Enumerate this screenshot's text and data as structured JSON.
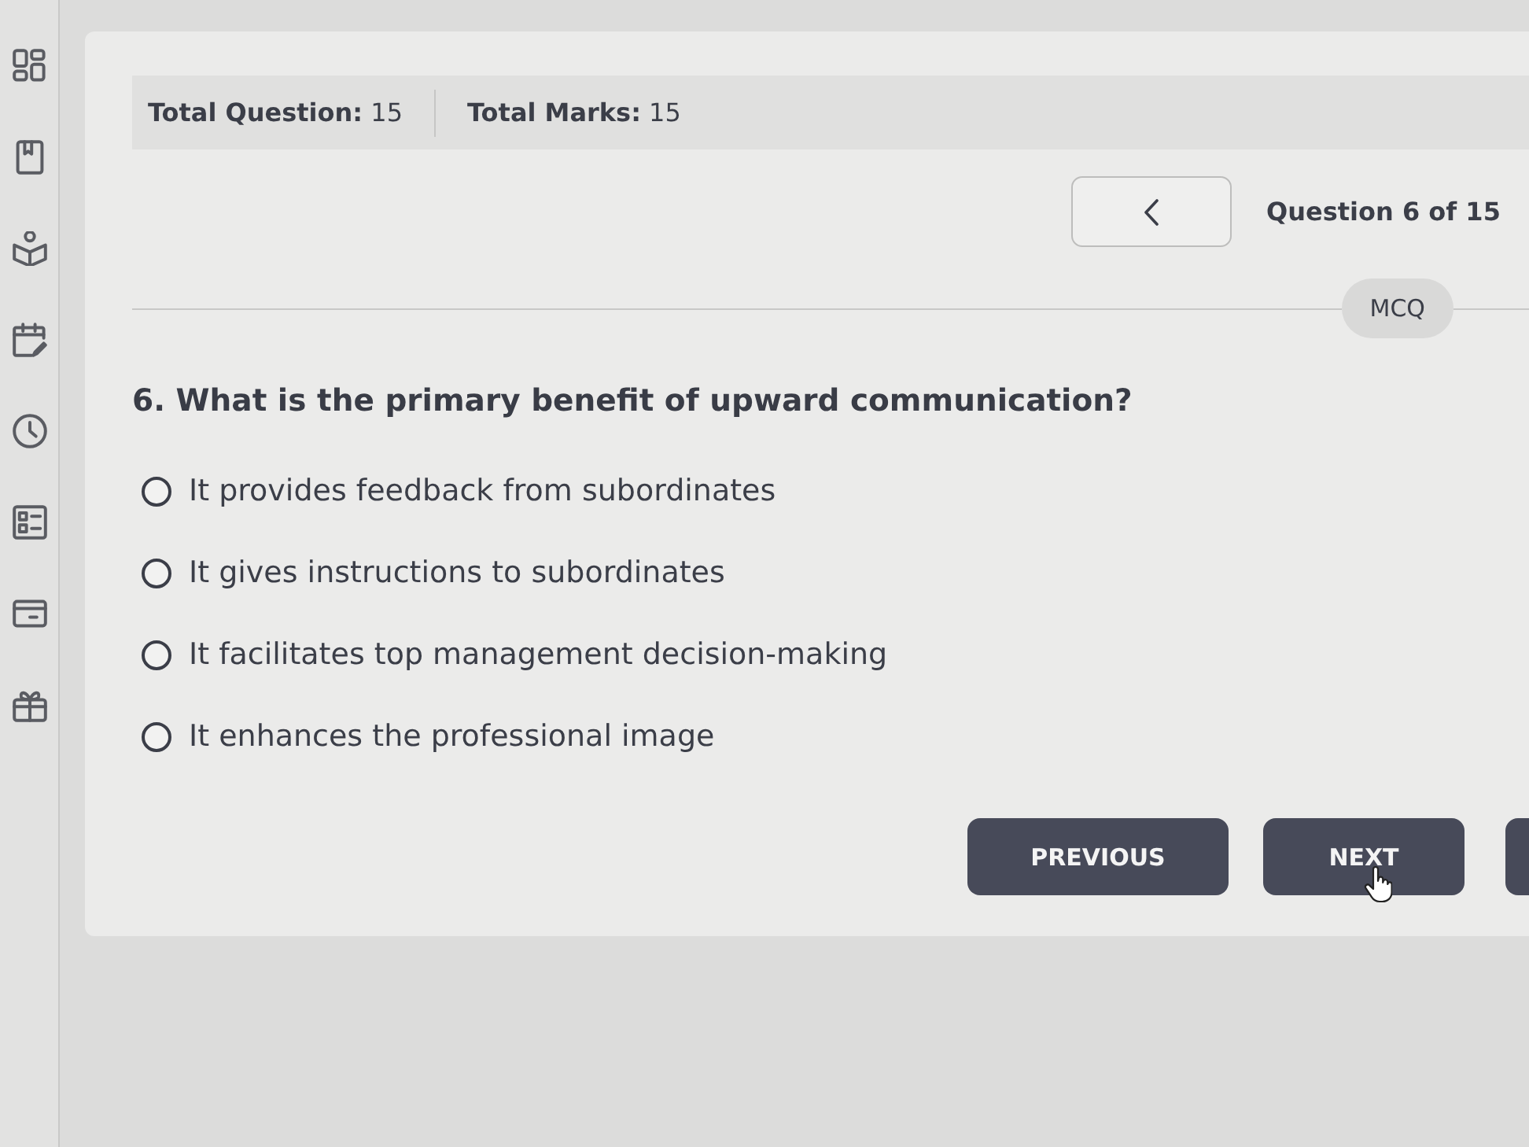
{
  "header": {
    "total_questions": "**Total Question:** 15",
    "total_marks": "**Total Marks:** 15"
  },
  "navigation": {
    "question_counter": "Question 6 of 15"
  },
  "question": {
    "type": "MCQ",
    "text": "6. What is the primary benefit of upward communication?",
    "options": [
      {
        "text": "It provides feedback from subordinates",
        "selected": false
      },
      {
        "text": "It gives instructions to subordinates",
        "selected": false
      },
      {
        "text": "It facilitates top management decision-making",
        "selected": false
      },
      {
        "text": "It enhances the professional image",
        "selected": false
      }
    ]
  },
  "buttons": [
    {
      "label": "PREVIOUS"
    },
    {
      "label": "NEXT"
    }
  ]
}
